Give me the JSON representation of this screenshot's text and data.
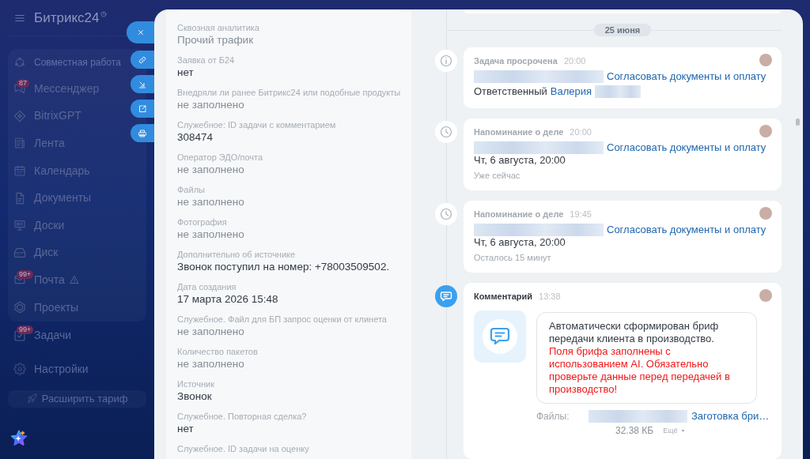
{
  "sidebar": {
    "logo": "Битрикс24",
    "section": {
      "title": "Совместная работа",
      "items": [
        {
          "label": "Мессенджер",
          "badge": "87",
          "alert": false
        },
        {
          "label": "BitrixGPT",
          "alert": false
        },
        {
          "label": "Лента",
          "alert": false
        },
        {
          "label": "Календарь",
          "alert": false
        },
        {
          "label": "Документы",
          "alert": false
        },
        {
          "label": "Доски",
          "alert": false
        },
        {
          "label": "Диск",
          "alert": false
        },
        {
          "label": "Почта",
          "badge": "99+",
          "alert": true
        },
        {
          "label": "Проекты",
          "alert": false
        }
      ]
    },
    "items": [
      {
        "label": "Задачи",
        "badge": "99+",
        "alert": false
      }
    ],
    "settings": "Настройки",
    "upgrade_button": "Расширить тариф"
  },
  "details": {
    "fields": [
      {
        "label": "Сквозная аналитика",
        "value": "Прочий трафик",
        "dimmed": true
      },
      {
        "label": "Заявка от Б24",
        "value": "нет",
        "dimmed": false
      },
      {
        "label": "Внедряли ли ранее Битрикс24 или подобные продукты",
        "value": "не заполнено",
        "dimmed": true
      },
      {
        "label": "Служебное: ID задачи с комментарием",
        "value": "308474",
        "dimmed": false
      },
      {
        "label": "Оператор ЭДО/почта",
        "value": "не заполнено",
        "dimmed": true
      },
      {
        "label": "Файлы",
        "value": "не заполнено",
        "dimmed": true
      },
      {
        "label": "Фотография",
        "value": "не заполнено",
        "dimmed": true
      },
      {
        "label": "Дополнительно об источнике",
        "value": "Звонок поступил на номер: +78003509502.",
        "dimmed": false
      },
      {
        "label": "Дата создания",
        "value": "17 марта 2026 15:48",
        "dimmed": false
      },
      {
        "label": "Служебное. Файл для БП запрос оценки от клинета",
        "value": "не заполнено",
        "dimmed": true
      },
      {
        "label": "Количество пакетов",
        "value": "не заполнено",
        "dimmed": true
      },
      {
        "label": "Источник",
        "value": "Звонок",
        "dimmed": false
      },
      {
        "label": "Служебное. Повторная сделка?",
        "value": "нет",
        "dimmed": false
      },
      {
        "label": "Служебное. ID задачи на оценку"
      }
    ]
  },
  "timeline": {
    "date": "25 июня",
    "entries": [
      {
        "kind": "task",
        "title": "Задача просрочена",
        "time": "20:00",
        "task": "Согласовать документы и оплату",
        "responsible_label": "Ответственный",
        "responsible": "Валерия"
      },
      {
        "kind": "reminder",
        "title": "Напоминание о деле",
        "time": "20:00",
        "task": "Согласовать документы и оплату",
        "deadline": "Чт, 6 августа, 20:00",
        "note": "Уже сейчас"
      },
      {
        "kind": "reminder",
        "title": "Напоминание о деле",
        "time": "19:45",
        "task": "Согласовать документы и оплату",
        "deadline": "Чт, 6 августа, 20:00",
        "note": "Осталось 15 минут"
      },
      {
        "kind": "comment",
        "title": "Комментарий",
        "time": "13:38",
        "message": "Автоматически сформирован бриф передачи клиента в производство.",
        "warning": "Поля брифа заполнены с использованием AI. Обязательно проверьте данные перед передачей в производство!",
        "files_label": "Файлы:",
        "file_name": "Заготовка бри…",
        "file_size": "32.38 КБ",
        "more_button": "Ещё"
      }
    ]
  }
}
